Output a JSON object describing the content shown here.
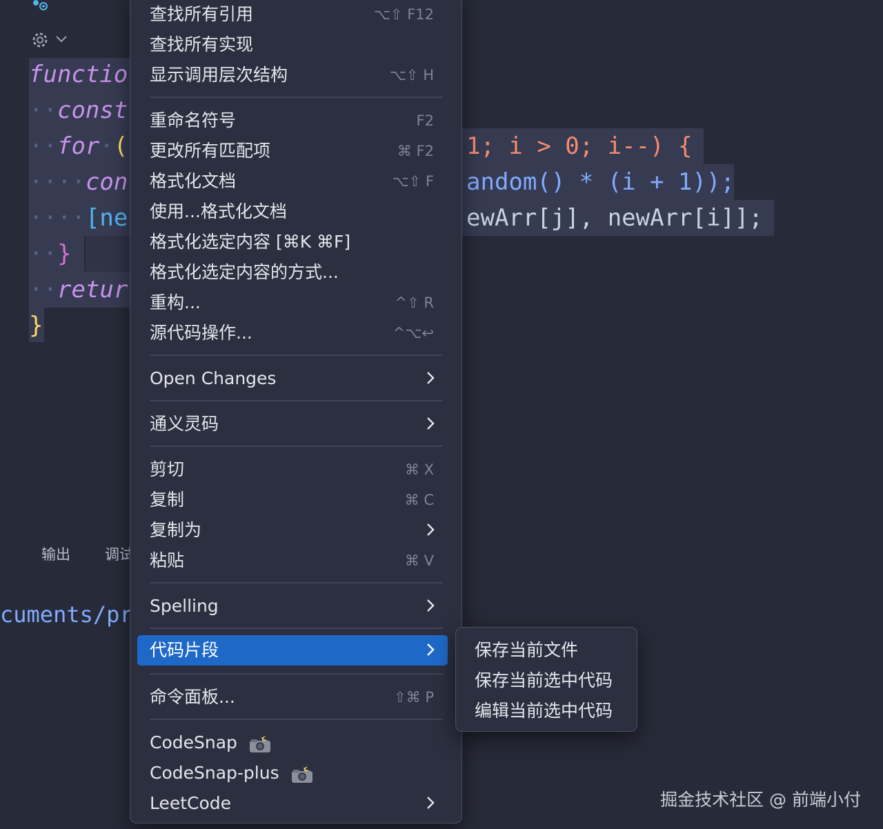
{
  "editor": {
    "lines": [
      {
        "visible_left": "functio",
        "kind": "keyword"
      },
      {
        "visible_left": "const",
        "kind": "keyword"
      },
      {
        "visible_left": "for",
        "paren": "(",
        "right": "1; i > 0; i--) {"
      },
      {
        "visible_left": "con",
        "right": "andom() * (i + 1));"
      },
      {
        "visible_left": "[ne",
        "right": "ewArr[j], newArr[i]];"
      },
      {
        "visible_left": "}"
      },
      {
        "visible_left": "retur"
      },
      {
        "visible_left": "}"
      }
    ]
  },
  "panel": {
    "tabs": [
      "输出",
      "调试"
    ],
    "terminal_text": "cuments/pro"
  },
  "context_menu": {
    "items": [
      {
        "label": "查找所有引用",
        "shortcut": "⌥⇧ F12"
      },
      {
        "label": "查找所有实现",
        "shortcut": ""
      },
      {
        "label": "显示调用层次结构",
        "shortcut": "⌥⇧ H"
      },
      {
        "label": "重命名符号",
        "shortcut": "F2"
      },
      {
        "label": "更改所有匹配项",
        "shortcut": "⌘ F2"
      },
      {
        "label": "格式化文档",
        "shortcut": "⌥⇧ F"
      },
      {
        "label": "使用...格式化文档",
        "shortcut": ""
      },
      {
        "label": "格式化选定内容 [⌘K ⌘F]",
        "shortcut": ""
      },
      {
        "label": "格式化选定内容的方式...",
        "shortcut": ""
      },
      {
        "label": "重构...",
        "shortcut": "^⇧ R"
      },
      {
        "label": "源代码操作...",
        "shortcut": "^⌥↩"
      },
      {
        "label": "Open Changes",
        "submenu": true
      },
      {
        "label": "通义灵码",
        "submenu": true
      },
      {
        "label": "剪切",
        "shortcut": "⌘ X"
      },
      {
        "label": "复制",
        "shortcut": "⌘ C"
      },
      {
        "label": "复制为",
        "submenu": true
      },
      {
        "label": "粘贴",
        "shortcut": "⌘ V"
      },
      {
        "label": "Spelling",
        "submenu": true
      },
      {
        "label": "代码片段",
        "submenu": true,
        "active": true
      },
      {
        "label": "命令面板...",
        "shortcut": "⇧⌘ P"
      },
      {
        "label": "CodeSnap",
        "icon": "camera-flash-icon"
      },
      {
        "label": "CodeSnap-plus",
        "icon": "camera-flash-icon"
      },
      {
        "label": "LeetCode",
        "submenu": true
      }
    ]
  },
  "submenu": {
    "items": [
      "保存当前文件",
      "保存当前选中代码",
      "编辑当前选中代码"
    ]
  },
  "watermark": "掘金技术社区 @ 前端小付",
  "colors": {
    "background": "#272a38",
    "menu_bg": "#2b2f3f",
    "active": "#1e69c8",
    "keyword": "#c792ea",
    "bracket_yellow": "#ffd866",
    "bracket_pink": "#d670d6",
    "bracket_blue": "#4fb6f0"
  }
}
